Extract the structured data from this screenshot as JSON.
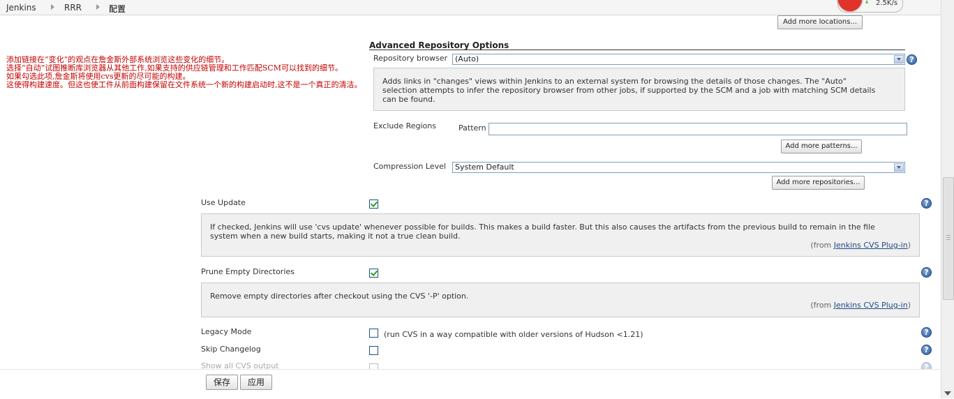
{
  "breadcrumb": [
    "Jenkins",
    "RRR",
    "配置"
  ],
  "network": {
    "speed": "2.5K/s",
    "arrow": "↓"
  },
  "annotation_lines": [
    "添加链接在“变化”的观点在詹金斯外部系统浏览这些变化的细节。",
    "选择“自动”试图推断库浏览器从其他工作,如果支持的供应链管理和工作匹配SCM可以找到的细节。",
    "如果勾选此项,詹金斯将使用cvs更新的尽可能的构建。",
    "这使得构建速度。但这也使工件从前面构建保留在文件系统一个新的构建启动时,这不是一个真正的清洁。"
  ],
  "buttons": {
    "add_locations": "Add more locations...",
    "add_patterns": "Add more patterns...",
    "add_repositories": "Add more repositories...",
    "save": "保存",
    "apply": "应用"
  },
  "advanced": {
    "title": "Advanced Repository Options",
    "repo_browser_label": "Repository browser",
    "repo_browser_value": "(Auto)",
    "repo_help": [
      "Adds links in \"changes\" views within Jenkins to an external system for browsing the details of those changes. The \"Auto\"",
      "selection attempts to infer the repository browser from other jobs, if supported by the SCM and a job with matching SCM details",
      "can be found."
    ],
    "exclude_label": "Exclude Regions",
    "pattern_label": "Pattern",
    "pattern_value": "",
    "compression_label": "Compression Level",
    "compression_value": "System Default"
  },
  "options": {
    "use_update": {
      "label": "Use Update",
      "checked": true,
      "help": [
        "If checked, Jenkins will use 'cvs update' whenever possible for builds. This makes a build faster. But this also causes the artifacts from the previous build to remain in the file",
        "system when a new build starts, making it not a true clean build."
      ],
      "from_prefix": "(from ",
      "from_link": "Jenkins CVS Plug-in",
      "from_suffix": ")"
    },
    "prune": {
      "label": "Prune Empty Directories",
      "checked": true,
      "help": "Remove empty directories after checkout using the CVS '-P' option.",
      "from_prefix": "(from ",
      "from_link": "Jenkins CVS Plug-in",
      "from_suffix": ")"
    },
    "legacy": {
      "label": "Legacy Mode",
      "checked": false,
      "desc": "(run CVS in a way compatible with older versions of Hudson <1.21)"
    },
    "skip_changelog": {
      "label": "Skip Changelog",
      "checked": false
    },
    "show_output": {
      "label": "Show all CVS output"
    }
  },
  "help_glyph": "?"
}
